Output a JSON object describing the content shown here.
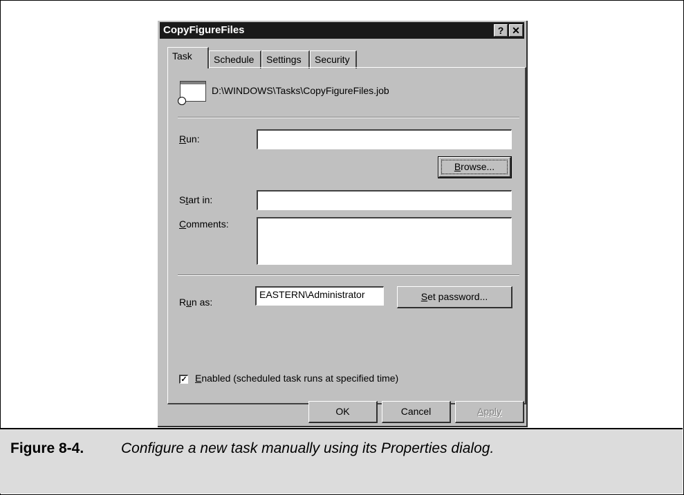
{
  "dialog": {
    "title": "CopyFigureFiles",
    "help_glyph": "?",
    "close_glyph": "✕"
  },
  "tabs": [
    "Task",
    "Schedule",
    "Settings",
    "Security"
  ],
  "task": {
    "job_path": "D:\\WINDOWS\\Tasks\\CopyFigureFiles.job",
    "run_label_mnemonic": "R",
    "run_label_rest": "un:",
    "run_value": "",
    "browse_label_mnemonic": "B",
    "browse_label_rest": "rowse...",
    "start_in_label_a": "S",
    "start_in_label_mnemonic": "t",
    "start_in_label_rest": "art in:",
    "start_in_value": "",
    "comments_label_mnemonic": "C",
    "comments_label_rest": "omments:",
    "comments_value": "",
    "run_as_label_a": "R",
    "run_as_label_mnemonic": "u",
    "run_as_label_rest": "n as:",
    "run_as_value": "EASTERN\\Administrator",
    "set_password_mnemonic": "S",
    "set_password_rest": "et password...",
    "enabled_check_glyph": "✓",
    "enabled_mnemonic": "E",
    "enabled_rest": "nabled (scheduled task runs at specified time)",
    "enabled_checked": true
  },
  "footer": {
    "ok": "OK",
    "cancel": "Cancel",
    "apply": "Apply"
  },
  "caption": {
    "number": "Figure 8-4.",
    "text": "Configure a new task manually using its Properties dialog."
  }
}
